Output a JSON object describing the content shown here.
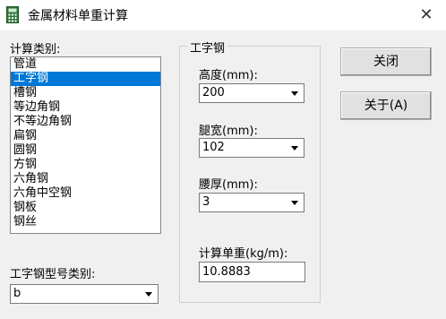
{
  "window": {
    "title": "金属材料单重计算",
    "close_glyph": "✕",
    "icon": "calculator-icon"
  },
  "calc_category": {
    "label": "计算类别:",
    "items": [
      "管道",
      "工字钢",
      "槽钢",
      "等边角钢",
      "不等边角钢",
      "扁钢",
      "圆钢",
      "方钢",
      "六角钢",
      "六角中空钢",
      "钢板",
      "钢丝"
    ],
    "selected": "工字钢"
  },
  "type_category": {
    "label": "工字钢型号类别:",
    "value": "b"
  },
  "group": {
    "title": "工字钢",
    "height": {
      "label": "高度(mm):",
      "value": "200"
    },
    "leg_width": {
      "label": "腿宽(mm):",
      "value": "102"
    },
    "waist_thickness": {
      "label": "腰厚(mm):",
      "value": "3"
    },
    "unit_weight": {
      "label": "计算单重(kg/m):",
      "value": "10.8883"
    }
  },
  "buttons": {
    "close": "关闭",
    "about": "关于(A)"
  },
  "colors": {
    "selection": "#0078d7",
    "background": "#f0f0f0"
  }
}
